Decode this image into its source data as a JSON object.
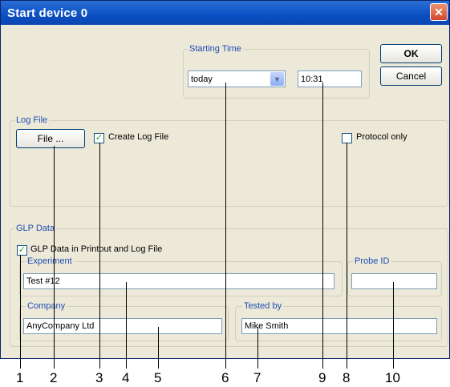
{
  "window": {
    "title": "Start device 0",
    "close_label": "✕"
  },
  "buttons": {
    "ok": "OK",
    "cancel": "Cancel",
    "file": "File ..."
  },
  "starting_time": {
    "group_label": "Starting Time",
    "day_value": "today",
    "time_value": "10:31"
  },
  "log_file": {
    "group_label": "Log File",
    "create_log_label": "Create Log File",
    "protocol_only_label": "Protocol only"
  },
  "glp": {
    "group_label": "GLP Data",
    "checkbox_label": "GLP Data in Printout and Log File",
    "experiment_label": "Experiment",
    "experiment_value": "Test #12",
    "probe_label": "Probe ID",
    "probe_value": "",
    "company_label": "Company",
    "company_value": "AnyCompany Ltd",
    "tested_by_label": "Tested by",
    "tested_by_value": "Mike Smith"
  },
  "callouts": [
    "1",
    "2",
    "3",
    "4",
    "5",
    "6",
    "7",
    "9",
    "8",
    "10"
  ]
}
